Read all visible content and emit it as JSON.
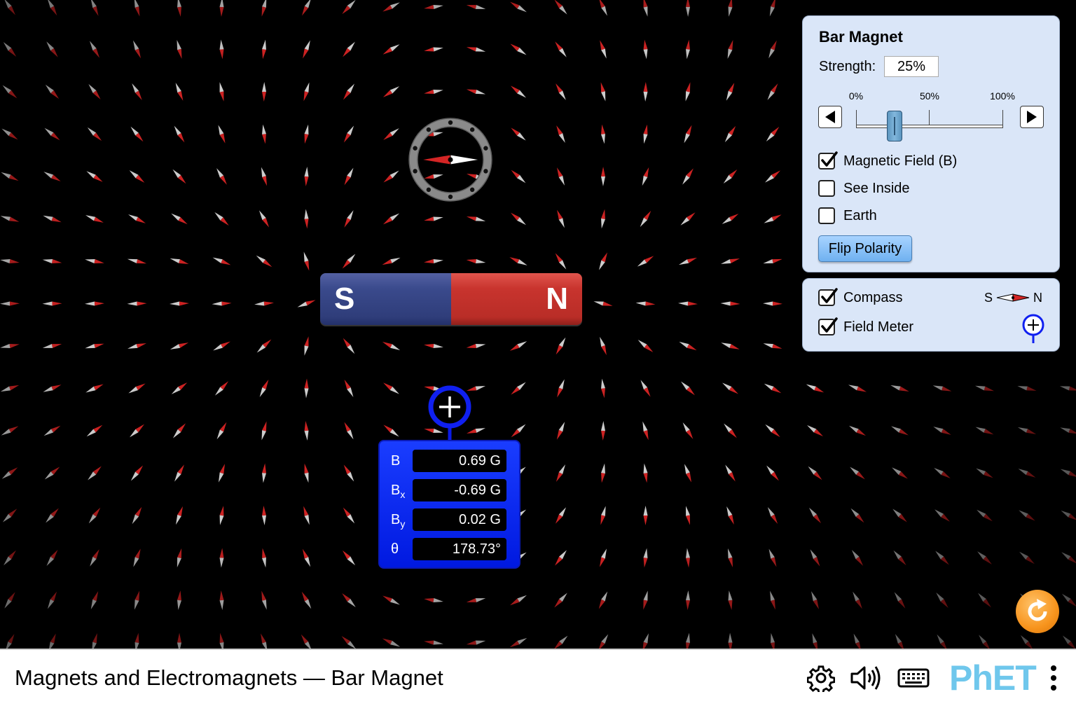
{
  "sim": {
    "magnet": {
      "south_label": "S",
      "north_label": "N"
    },
    "field_meter": {
      "rows": [
        {
          "label": "B",
          "sub": "",
          "value": "0.69 G"
        },
        {
          "label": "B",
          "sub": "x",
          "value": "-0.69 G"
        },
        {
          "label": "B",
          "sub": "y",
          "value": "0.02 G"
        },
        {
          "label": "θ",
          "sub": "",
          "value": "178.73°"
        }
      ]
    }
  },
  "bar_magnet_panel": {
    "title": "Bar Magnet",
    "strength_label": "Strength:",
    "strength_value": "25%",
    "strength_fraction": 0.25,
    "tick_labels": [
      "0%",
      "50%",
      "100%"
    ],
    "checkboxes": [
      {
        "label": "Magnetic Field (B)",
        "checked": true
      },
      {
        "label": "See Inside",
        "checked": false
      },
      {
        "label": "Earth",
        "checked": false
      }
    ],
    "flip_button": "Flip Polarity"
  },
  "tools_panel": {
    "checkboxes": [
      {
        "label": "Compass",
        "checked": true
      },
      {
        "label": "Field Meter",
        "checked": true
      }
    ],
    "compass_legend": {
      "s": "S",
      "n": "N"
    }
  },
  "navbar": {
    "title": "Magnets and Electromagnets — Bar Magnet",
    "logo_text": "PhET"
  },
  "colors": {
    "north": "#c8342e",
    "south": "#3a4a8c",
    "panel": "#dae6f8",
    "meter": "#0019e0",
    "reset": "#f7941d"
  }
}
